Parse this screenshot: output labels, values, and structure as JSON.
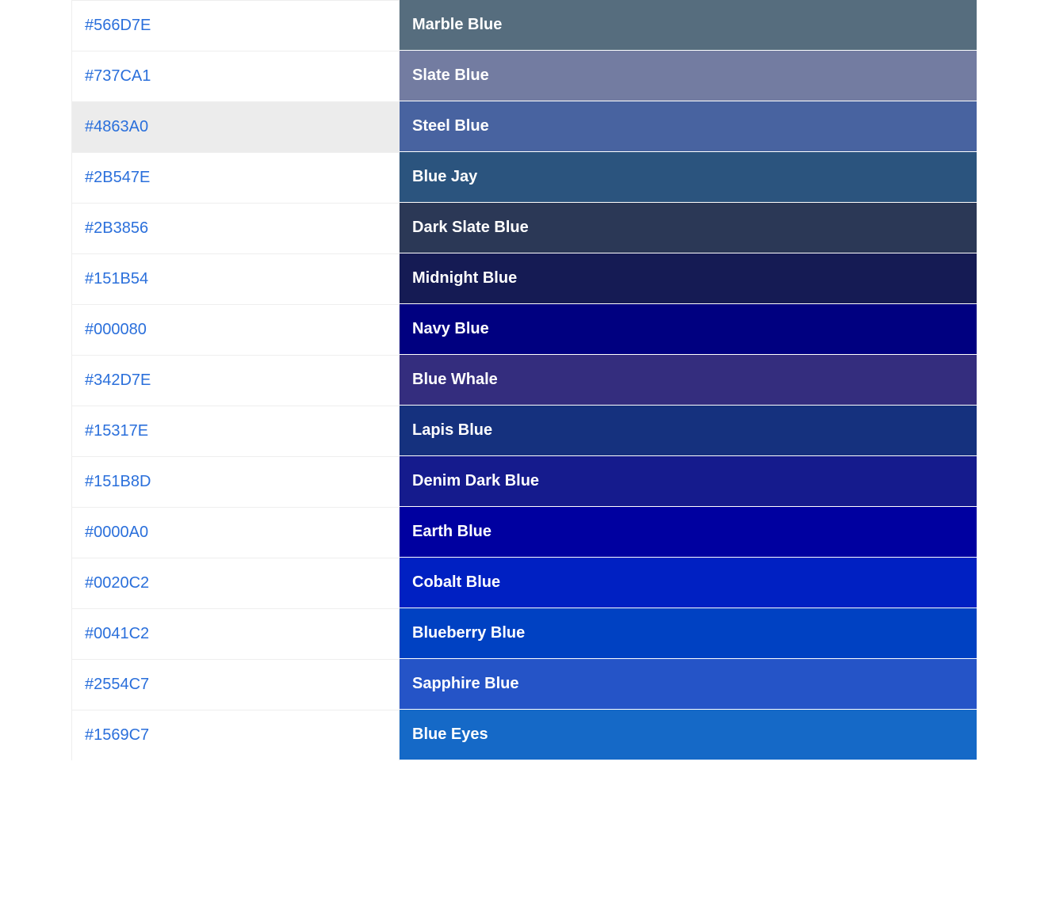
{
  "hover_index": 2,
  "colors": [
    {
      "hex": "#566D7E",
      "name": "Marble Blue",
      "bg": "#566D7E"
    },
    {
      "hex": "#737CA1",
      "name": "Slate Blue",
      "bg": "#737CA1"
    },
    {
      "hex": "#4863A0",
      "name": "Steel Blue",
      "bg": "#4863A0"
    },
    {
      "hex": "#2B547E",
      "name": "Blue Jay",
      "bg": "#2B547E"
    },
    {
      "hex": "#2B3856",
      "name": "Dark Slate Blue",
      "bg": "#2B3856"
    },
    {
      "hex": "#151B54",
      "name": "Midnight Blue",
      "bg": "#151B54"
    },
    {
      "hex": "#000080",
      "name": "Navy Blue",
      "bg": "#000080"
    },
    {
      "hex": "#342D7E",
      "name": "Blue Whale",
      "bg": "#342D7E"
    },
    {
      "hex": "#15317E",
      "name": "Lapis Blue",
      "bg": "#15317E"
    },
    {
      "hex": "#151B8D",
      "name": "Denim Dark Blue",
      "bg": "#151B8D"
    },
    {
      "hex": "#0000A0",
      "name": "Earth Blue",
      "bg": "#0000A0"
    },
    {
      "hex": "#0020C2",
      "name": "Cobalt Blue",
      "bg": "#0020C2"
    },
    {
      "hex": "#0041C2",
      "name": "Blueberry Blue",
      "bg": "#0041C2"
    },
    {
      "hex": "#2554C7",
      "name": "Sapphire Blue",
      "bg": "#2554C7"
    },
    {
      "hex": "#1569C7",
      "name": "Blue Eyes",
      "bg": "#1569C7"
    }
  ]
}
